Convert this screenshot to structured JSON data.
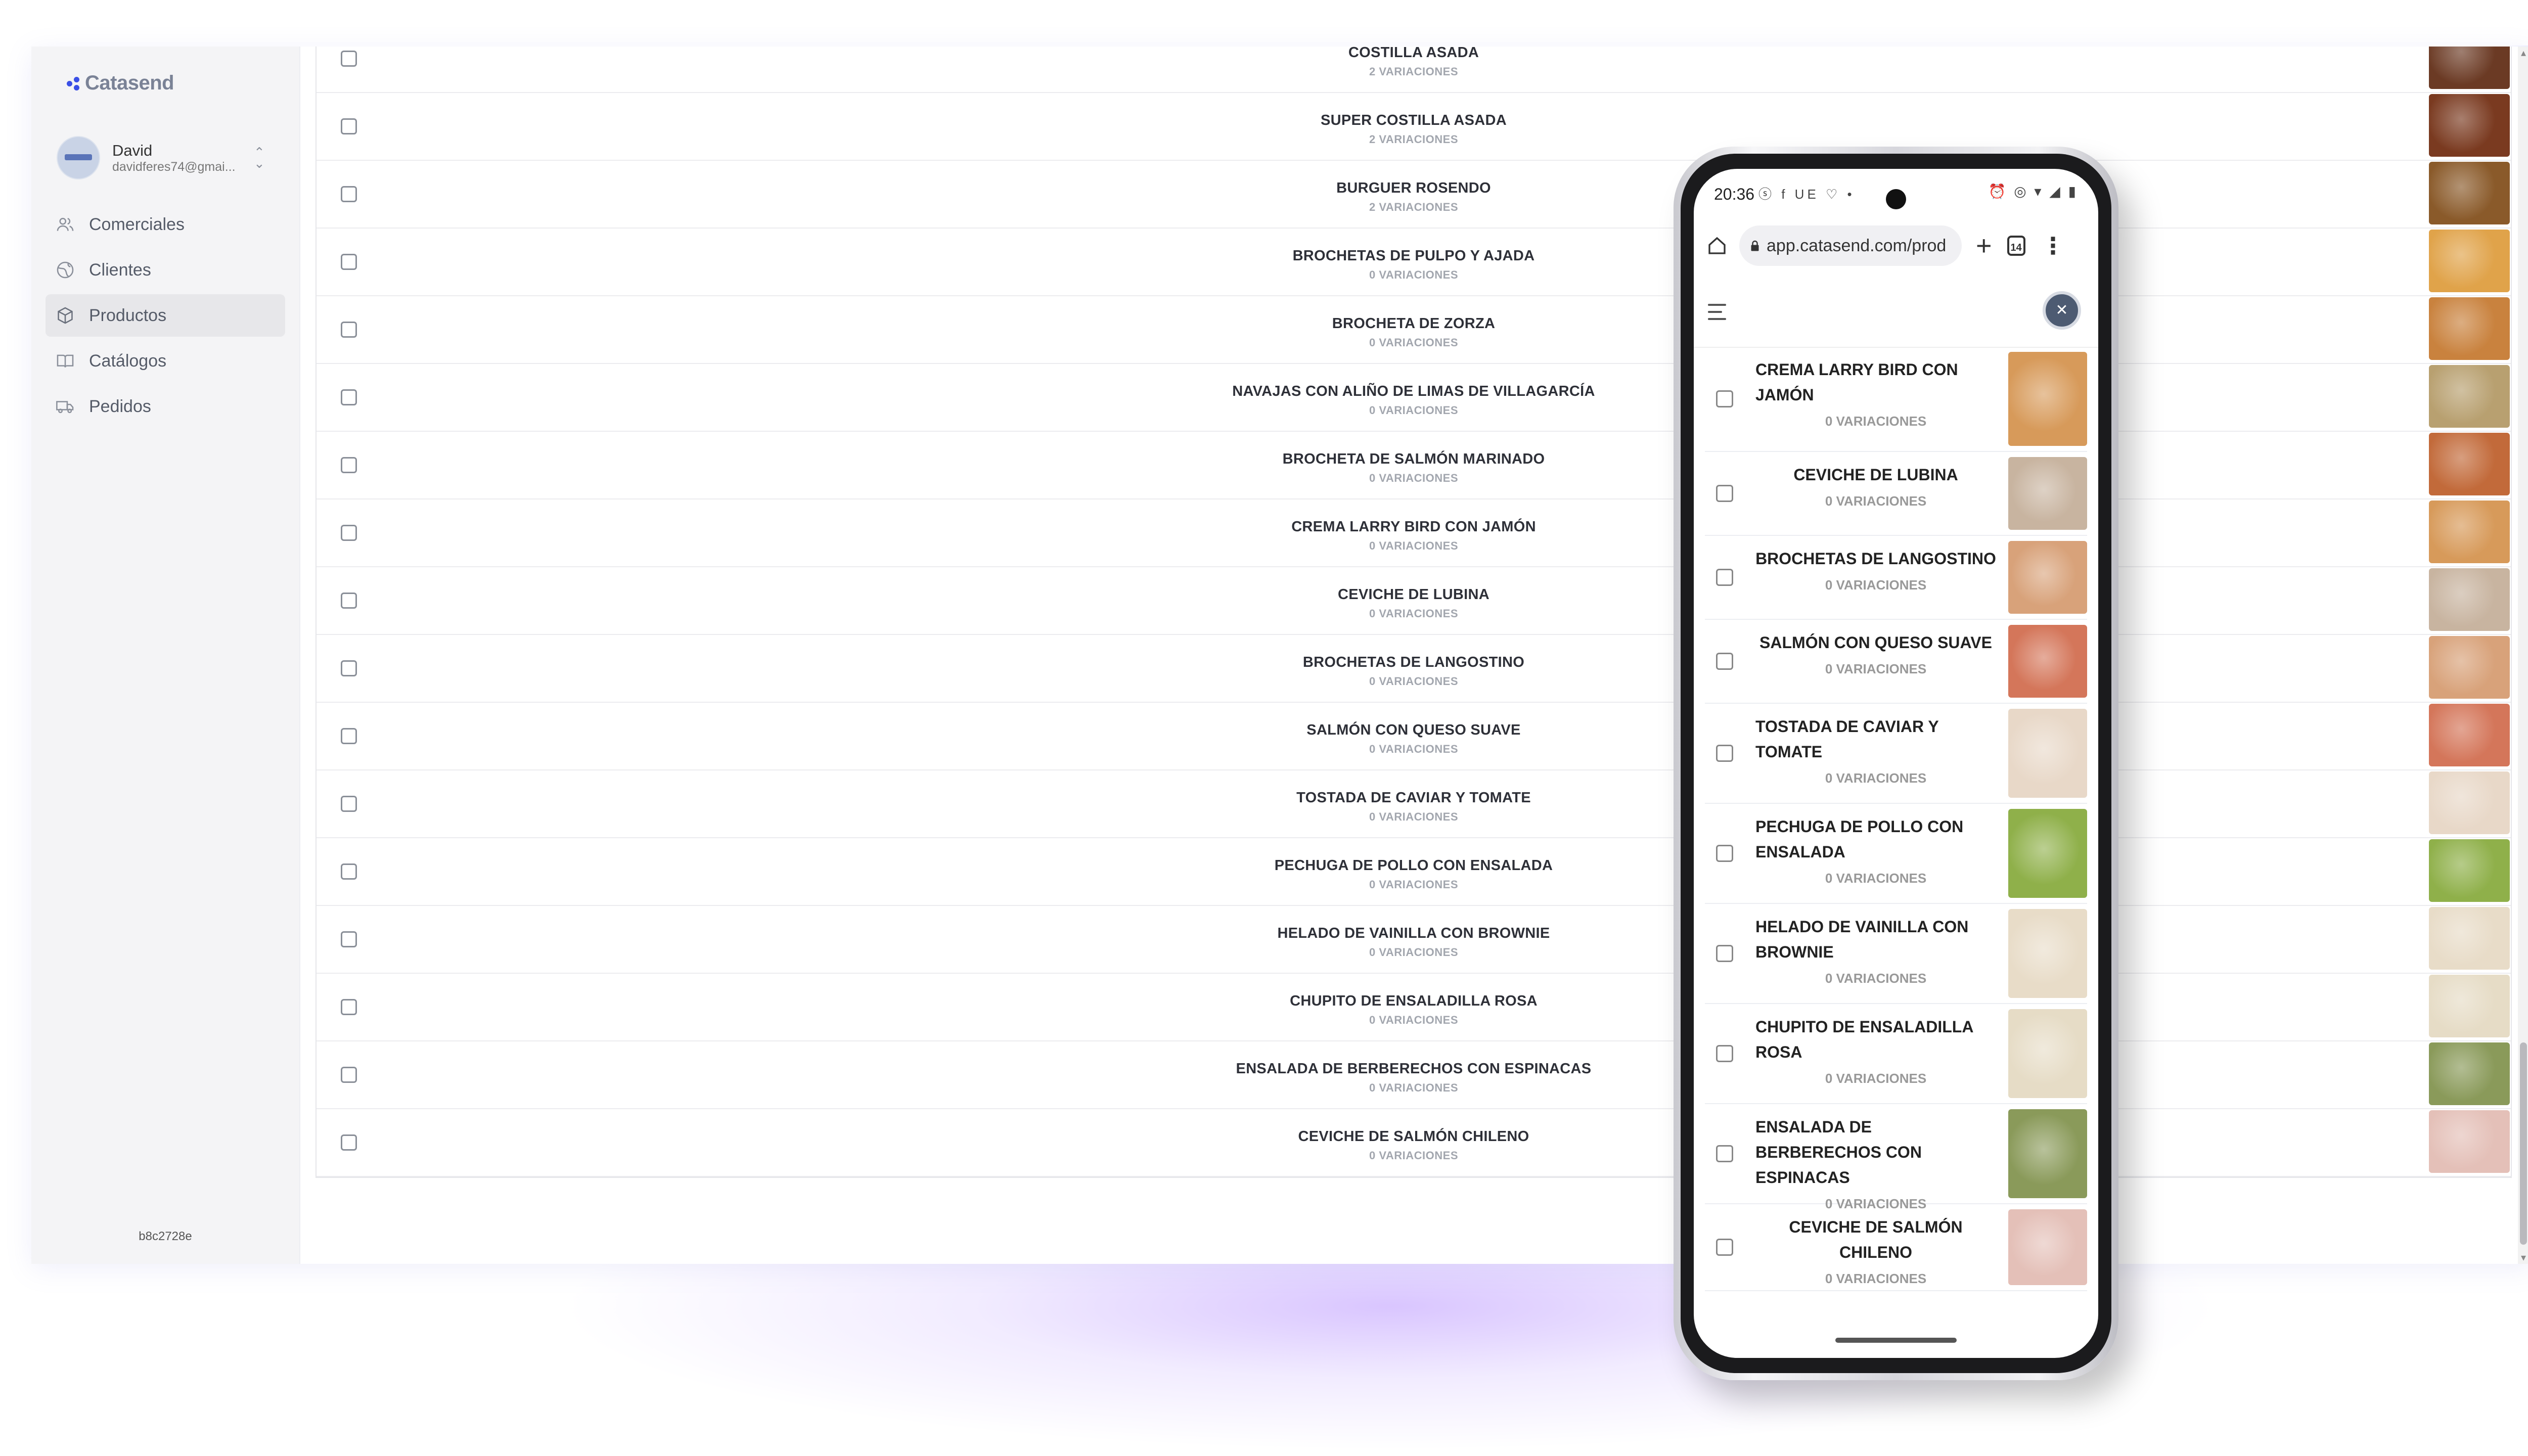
{
  "sidebar": {
    "brand": "Catasend",
    "user": {
      "name": "David",
      "email": "davidferes74@gmai..."
    },
    "nav": [
      {
        "label": "Comerciales",
        "icon": "users-icon"
      },
      {
        "label": "Clientes",
        "icon": "globe-icon"
      },
      {
        "label": "Productos",
        "icon": "box-icon",
        "active": true
      },
      {
        "label": "Catálogos",
        "icon": "book-icon"
      },
      {
        "label": "Pedidos",
        "icon": "truck-icon"
      }
    ],
    "version": "b8c2728e"
  },
  "products": [
    {
      "name": "COSTILLA ASADA",
      "variations": "2 VARIACIONES",
      "color": "#6b3a24"
    },
    {
      "name": "SUPER COSTILLA ASADA",
      "variations": "2 VARIACIONES",
      "color": "#7a3a20"
    },
    {
      "name": "BURGUER ROSENDO",
      "variations": "2 VARIACIONES",
      "color": "#8a5a2a"
    },
    {
      "name": "BROCHETAS DE PULPO Y AJADA",
      "variations": "0 VARIACIONES",
      "color": "#e0a34a"
    },
    {
      "name": "BROCHETA DE ZORZA",
      "variations": "0 VARIACIONES",
      "color": "#c9823e"
    },
    {
      "name": "NAVAJAS CON ALIÑO DE LIMAS DE VILLAGARCÍA",
      "variations": "0 VARIACIONES",
      "color": "#b8a070"
    },
    {
      "name": "BROCHETA DE SALMÓN MARINADO",
      "variations": "0 VARIACIONES",
      "color": "#c26a3a"
    },
    {
      "name": "CREMA LARRY BIRD CON JAMÓN",
      "variations": "0 VARIACIONES",
      "color": "#d79a5a"
    },
    {
      "name": "CEVICHE DE LUBINA",
      "variations": "0 VARIACIONES",
      "color": "#c8b4a0"
    },
    {
      "name": "BROCHETAS DE LANGOSTINO",
      "variations": "0 VARIACIONES",
      "color": "#d8a27a"
    },
    {
      "name": "SALMÓN CON QUESO SUAVE",
      "variations": "0 VARIACIONES",
      "color": "#d4765a"
    },
    {
      "name": "TOSTADA DE CAVIAR Y TOMATE",
      "variations": "0 VARIACIONES",
      "color": "#e8d8c8"
    },
    {
      "name": "PECHUGA DE POLLO CON ENSALADA",
      "variations": "0 VARIACIONES",
      "color": "#8fb04a"
    },
    {
      "name": "HELADO DE VAINILLA CON BROWNIE",
      "variations": "0 VARIACIONES",
      "color": "#e8dcc8"
    },
    {
      "name": "CHUPITO DE ENSALADILLA ROSA",
      "variations": "0 VARIACIONES",
      "color": "#e6dcc6"
    },
    {
      "name": "ENSALADA DE BERBERECHOS CON ESPINACAS",
      "variations": "0 VARIACIONES",
      "color": "#8a9a5a"
    },
    {
      "name": "CEVICHE DE SALMÓN CHILENO",
      "variations": "0 VARIACIONES",
      "color": "#e4c0b8"
    }
  ],
  "phone": {
    "time": "20:36",
    "status_left": "ⓢ f UE ♡ •",
    "url": "app.catasend.com/prod",
    "tabs_count": "14",
    "logo": "✕",
    "items": [
      {
        "name": "CREMA LARRY BIRD CON JAMÓN",
        "variations": "0 VARIACIONES",
        "color": "#d79a5a",
        "centered": false
      },
      {
        "name": "CEVICHE DE LUBINA",
        "variations": "0 VARIACIONES",
        "color": "#c8b4a0",
        "centered": true
      },
      {
        "name": "BROCHETAS DE LANGOSTINO",
        "variations": "0 VARIACIONES",
        "color": "#d8a27a",
        "centered": true
      },
      {
        "name": "SALMÓN CON QUESO SUAVE",
        "variations": "0 VARIACIONES",
        "color": "#d4765a",
        "centered": true
      },
      {
        "name": "TOSTADA DE CAVIAR Y TOMATE",
        "variations": "0 VARIACIONES",
        "color": "#e8d8c8",
        "centered": false
      },
      {
        "name": "PECHUGA DE POLLO CON ENSALADA",
        "variations": "0 VARIACIONES",
        "color": "#8fb04a",
        "centered": false
      },
      {
        "name": "HELADO DE VAINILLA CON BROWNIE",
        "variations": "0 VARIACIONES",
        "color": "#e8dcc8",
        "centered": false
      },
      {
        "name": "CHUPITO DE ENSALADILLA ROSA",
        "variations": "0 VARIACIONES",
        "color": "#e6dcc6",
        "centered": false
      },
      {
        "name": "ENSALADA DE BERBERECHOS CON ESPINACAS",
        "variations": "0 VARIACIONES",
        "color": "#8a9a5a",
        "centered": false
      },
      {
        "name": "CEVICHE DE SALMÓN CHILENO",
        "variations": "0 VARIACIONES",
        "color": "#e4c0b8",
        "centered": true
      }
    ]
  },
  "colors": {
    "accent": "#3a4fe6",
    "active_nav": "#e7e7ea"
  }
}
